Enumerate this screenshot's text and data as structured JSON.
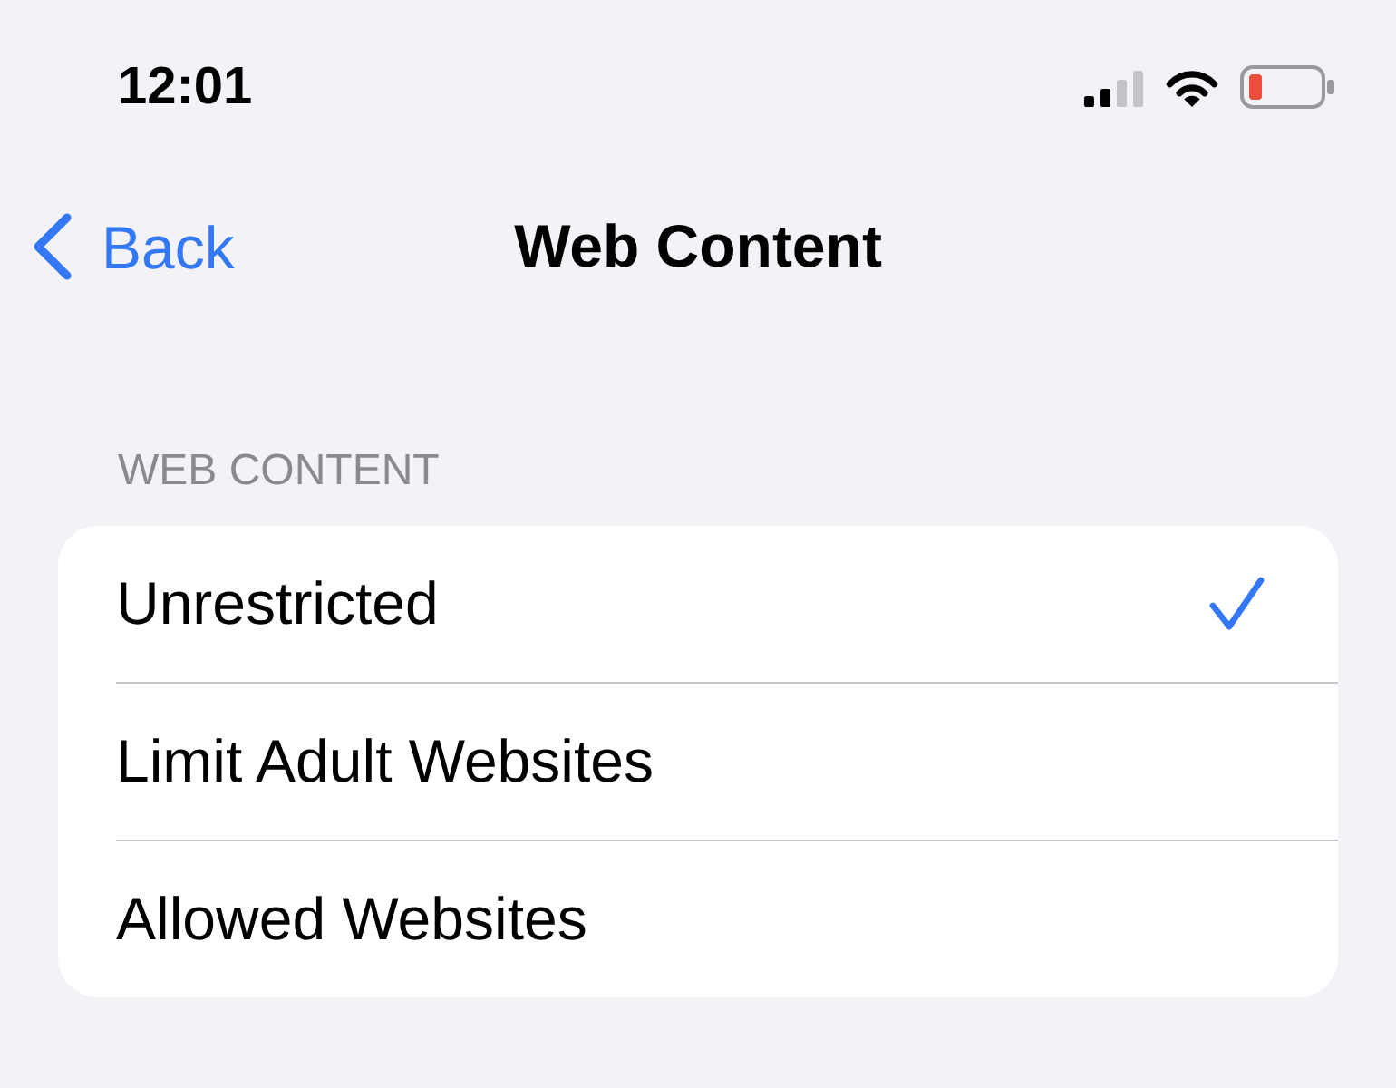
{
  "status_bar": {
    "time": "12:01"
  },
  "nav": {
    "back": "Back",
    "title": "Web Content"
  },
  "section": {
    "header": "WEB CONTENT",
    "options": [
      {
        "label": "Unrestricted",
        "selected": true
      },
      {
        "label": "Limit Adult Websites",
        "selected": false
      },
      {
        "label": "Allowed Websites",
        "selected": false
      }
    ]
  }
}
